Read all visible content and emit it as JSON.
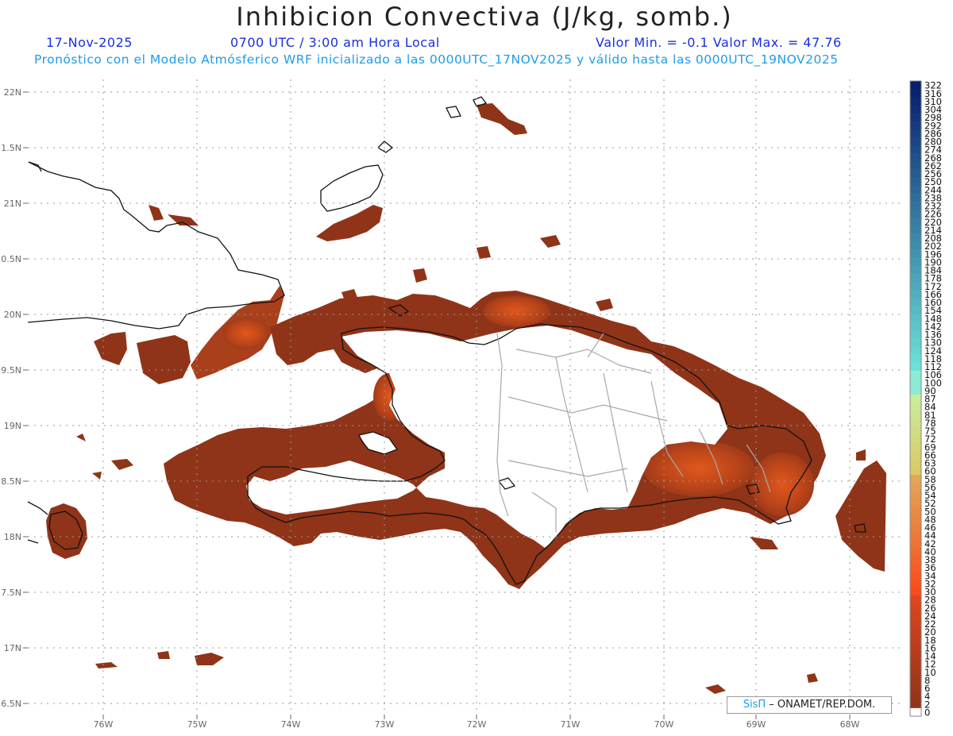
{
  "header": {
    "title": "Inhibicion Convectiva (J/kg, somb.)",
    "date": "17-Nov-2025",
    "time": "0700 UTC / 3:00 am Hora Local",
    "minmax": "Valor Min. = -0.1   Valor Max. = 47.76",
    "model_line": "Pronóstico con el Modelo Atmósferico WRF inicializado a las 0000UTC_17NOV2025 y válido hasta las  0000UTC_19NOV2025"
  },
  "axes": {
    "lat_labels": [
      "22N",
      "1.5N",
      "21N",
      "0.5N",
      "20N",
      "9.5N",
      "19N",
      "8.5N",
      "18N",
      "7.5N",
      "17N",
      "6.5N"
    ],
    "lon_labels": [
      "76W",
      "75W",
      "74W",
      "73W",
      "72W",
      "71W",
      "70W",
      "69W",
      "68W"
    ]
  },
  "colorbar": {
    "labels": [
      "322",
      "316",
      "310",
      "304",
      "298",
      "292",
      "286",
      "280",
      "274",
      "268",
      "262",
      "256",
      "250",
      "244",
      "238",
      "232",
      "226",
      "220",
      "214",
      "208",
      "202",
      "196",
      "190",
      "184",
      "178",
      "172",
      "166",
      "160",
      "154",
      "148",
      "142",
      "136",
      "130",
      "124",
      "118",
      "112",
      "106",
      "100",
      "90",
      "87",
      "84",
      "81",
      "78",
      "75",
      "72",
      "69",
      "66",
      "63",
      "60",
      "58",
      "56",
      "54",
      "52",
      "50",
      "48",
      "46",
      "44",
      "42",
      "40",
      "38",
      "36",
      "34",
      "32",
      "30",
      "28",
      "26",
      "24",
      "22",
      "20",
      "18",
      "16",
      "14",
      "12",
      "10",
      "8",
      "6",
      "4",
      "2",
      "0"
    ]
  },
  "credit": {
    "logo": "SisΠ",
    "text": "– ONAMET/REP.DOM."
  },
  "colors": {
    "cin_fill": "#8f3418",
    "cin_high": "#d4501a",
    "coast": "#111111",
    "provinces": "#a8a8a8",
    "grid": "#9a9a9a"
  }
}
